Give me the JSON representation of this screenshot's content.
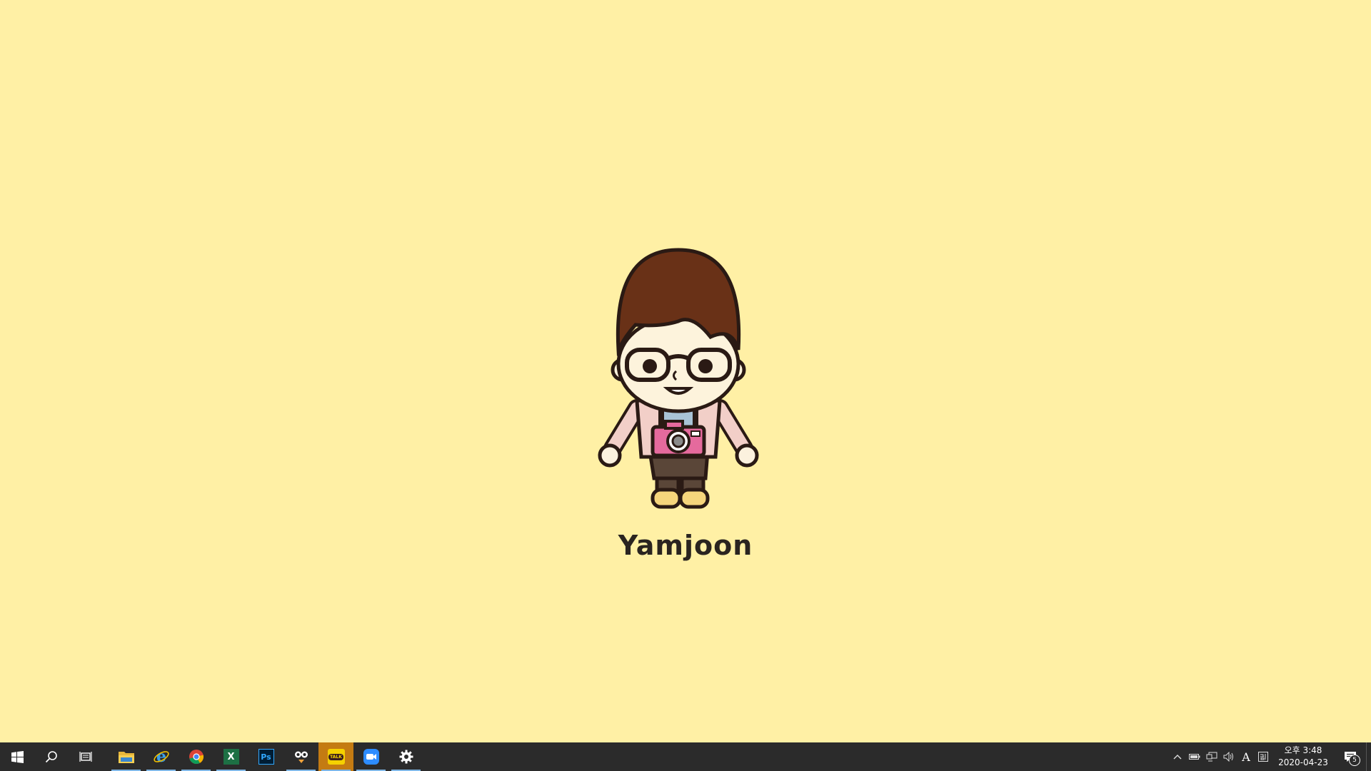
{
  "wallpaper": {
    "name": "Yamjoon",
    "background_color": "#fff0a5"
  },
  "taskbar": {
    "start_icon": "windows-logo-icon",
    "search_icon": "search-icon",
    "task_view_icon": "task-view-icon",
    "apps": [
      {
        "icon": "file-explorer-icon",
        "running": true
      },
      {
        "icon": "internet-explorer-icon",
        "running": true
      },
      {
        "icon": "chrome-icon",
        "running": true
      },
      {
        "icon": "excel-icon",
        "running": true
      },
      {
        "icon": "photoshop-icon",
        "running": false
      },
      {
        "icon": "bandizip-icon",
        "running": true
      },
      {
        "icon": "kakaotalk-icon",
        "running": true,
        "active": true
      },
      {
        "icon": "zoom-icon",
        "running": true
      },
      {
        "icon": "settings-icon",
        "running": true
      }
    ],
    "tray": {
      "show_hidden_icon": "chevron-up-icon",
      "icons": [
        "battery-icon",
        "network-icon",
        "volume-icon"
      ],
      "ime_mode": "A",
      "ime_hangul_icon": "korean-ime-icon",
      "time": "오후 3:48",
      "date": "2020-04-23",
      "notification_count": "5"
    }
  },
  "logo_text": {
    "photoshop": "Ps",
    "excel": "X",
    "kakaotalk": "TALK"
  }
}
